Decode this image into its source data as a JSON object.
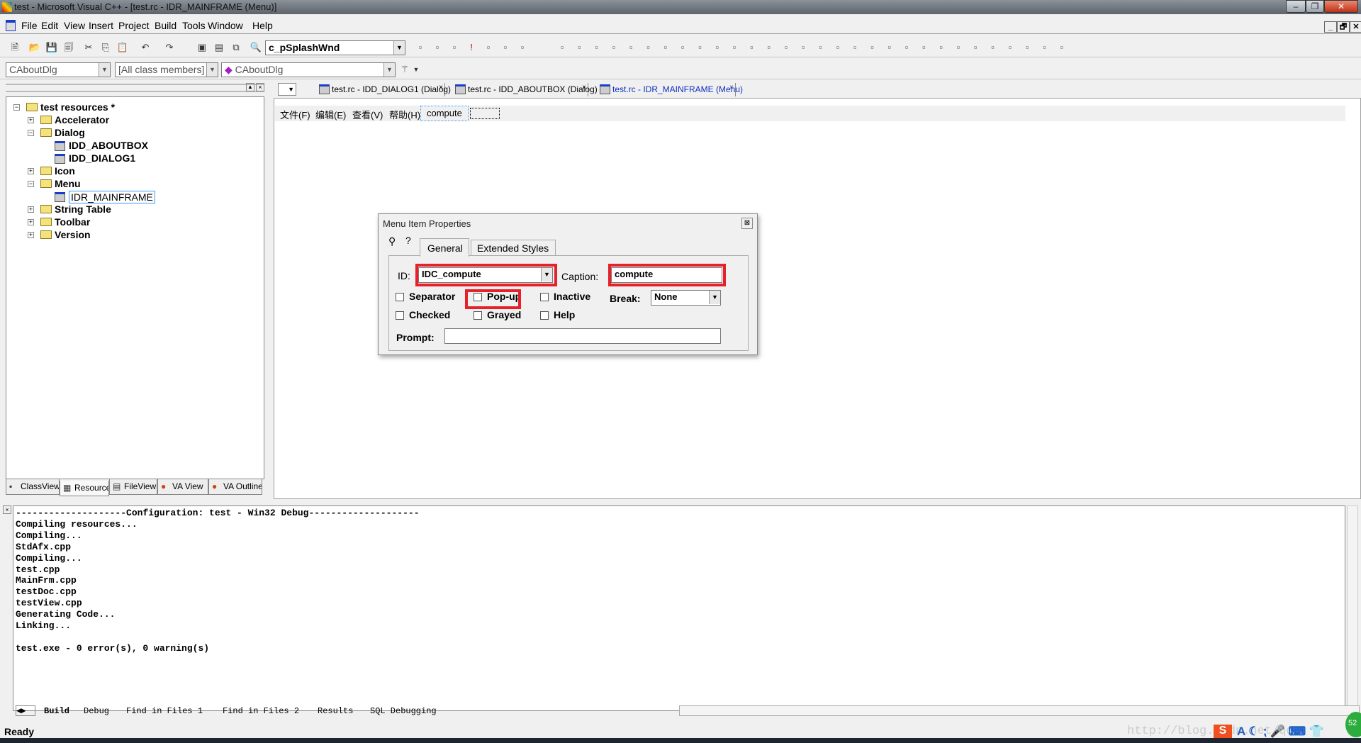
{
  "window": {
    "title": "test - Microsoft Visual C++ - [test.rc - IDR_MAINFRAME (Menu)]",
    "min": "–",
    "max": "❐",
    "close": "✕"
  },
  "menubar": [
    "File",
    "Edit",
    "View",
    "Insert",
    "Project",
    "Build",
    "Tools",
    "Window",
    "Help"
  ],
  "mdi_buttons": [
    "_",
    "🗗",
    "✕"
  ],
  "toolbar1": {
    "icons": [
      "new-text-icon",
      "open-icon",
      "save-icon",
      "save-all-icon",
      "cut-icon",
      "copy-icon",
      "paste-icon",
      "undo-icon",
      "redo-icon",
      "workspace-icon",
      "output-icon",
      "window-list-icon",
      "find-in-files-icon"
    ],
    "find_value": "c_pSplashWnd",
    "right_icons": [
      "find-icon",
      "compile-icon",
      "build-icon",
      "stop-build-icon",
      "execute-icon",
      "go-icon",
      "insert-breakpoint-icon",
      "va-icon1",
      "va-icon2",
      "va-icon3",
      "va-icon4",
      "va-icon5",
      "va-icon6",
      "va-icon7",
      "va-icon8",
      "va-icon9",
      "va-icon10",
      "va-icon11",
      "va-icon12",
      "va-icon13",
      "va-icon14",
      "va-icon15",
      "va-icon16",
      "va-icon17",
      "va-icon18",
      "va-icon19",
      "va-icon20",
      "va-icon21",
      "va-icon22",
      "va-icon23",
      "va-icon24",
      "va-icon25",
      "va-icon26",
      "va-icon27",
      "va-icon28",
      "va-icon29",
      "va-icon30"
    ]
  },
  "toolbar2": {
    "class": "CAboutDlg",
    "filter": "[All class members]",
    "member": "CAboutDlg"
  },
  "workspace": {
    "tree": [
      {
        "label": "test resources *",
        "level": 0,
        "type": "folder-open",
        "expander": "−"
      },
      {
        "label": "Accelerator",
        "level": 1,
        "type": "folder",
        "expander": "+"
      },
      {
        "label": "Dialog",
        "level": 1,
        "type": "folder-open",
        "expander": "−"
      },
      {
        "label": "IDD_ABOUTBOX",
        "level": 2,
        "type": "dialog"
      },
      {
        "label": "IDD_DIALOG1",
        "level": 2,
        "type": "dialog"
      },
      {
        "label": "Icon",
        "level": 1,
        "type": "folder",
        "expander": "+"
      },
      {
        "label": "Menu",
        "level": 1,
        "type": "folder-open",
        "expander": "−"
      },
      {
        "label": "IDR_MAINFRAME",
        "level": 2,
        "type": "menu",
        "selected": true
      },
      {
        "label": "String Table",
        "level": 1,
        "type": "folder",
        "expander": "+"
      },
      {
        "label": "Toolbar",
        "level": 1,
        "type": "folder",
        "expander": "+"
      },
      {
        "label": "Version",
        "level": 1,
        "type": "folder",
        "expander": "+"
      }
    ],
    "tabs": [
      "ClassView",
      "Resource",
      "FileView",
      "VA View",
      "VA Outline"
    ]
  },
  "editor": {
    "tabs": [
      {
        "label": "test.rc - IDD_DIALOG1 (Dialog)",
        "active": false
      },
      {
        "label": "test.rc - IDD_ABOUTBOX (Dialog)",
        "active": false
      },
      {
        "label": "test.rc - IDR_MAINFRAME (Menu)",
        "active": true
      }
    ],
    "tab_close": "×",
    "menu_preview": [
      "文件(F)",
      "编辑(E)",
      "查看(V)",
      "帮助(H)",
      "compute"
    ]
  },
  "dialog": {
    "title": "Menu Item Properties",
    "close": "⊠",
    "tabs": [
      "General",
      "Extended Styles"
    ],
    "id_label": "ID:",
    "id_value": "IDC_compute",
    "caption_label": "Caption:",
    "caption_value": "compute",
    "checkboxes": [
      {
        "label": "Separator",
        "checked": false
      },
      {
        "label": "Pop-up",
        "checked": false
      },
      {
        "label": "Inactive",
        "checked": false
      },
      {
        "label": "Checked",
        "checked": false
      },
      {
        "label": "Grayed",
        "checked": false
      },
      {
        "label": "Help",
        "checked": false
      }
    ],
    "break_label": "Break:",
    "break_value": "None",
    "prompt_label": "Prompt:",
    "prompt_value": "",
    "highlight_color": "#e8202a"
  },
  "output": {
    "lines": [
      "--------------------Configuration: test - Win32 Debug--------------------",
      "Compiling resources...",
      "Compiling...",
      "StdAfx.cpp",
      "Compiling...",
      "test.cpp",
      "MainFrm.cpp",
      "testDoc.cpp",
      "testView.cpp",
      "Generating Code...",
      "Linking...",
      "",
      "test.exe - 0 error(s), 0 warning(s)"
    ],
    "tabs": [
      "Build",
      "Debug",
      "Find in Files 1",
      "Find in Files 2",
      "Results",
      "SQL Debugging"
    ]
  },
  "status": {
    "text": "Ready",
    "watermark": "http://blog.csdn.net/qq_",
    "clock_badge": "52"
  }
}
